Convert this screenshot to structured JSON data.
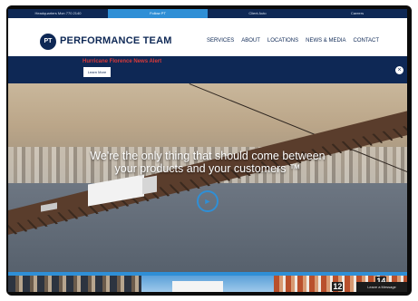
{
  "utility_bar": [
    {
      "label": "Headquarters Mon 770 2140"
    },
    {
      "label": "Follow PT"
    },
    {
      "label": "Client Auto"
    },
    {
      "label": "Careers"
    }
  ],
  "brand": {
    "mark": "PT",
    "name": "PERFORMANCE TEAM"
  },
  "nav": [
    "SERVICES",
    "ABOUT",
    "LOCATIONS",
    "NEWS & MEDIA",
    "CONTACT"
  ],
  "alert": {
    "title": "Hurricane Florence News Alert",
    "button": "Learn More",
    "close": "×"
  },
  "hero": {
    "tagline_line1": "We're the only thing that should come between",
    "tagline_line2": "your products and your customers ™"
  },
  "tiles": {
    "num1": "12",
    "num2": "14"
  },
  "chat": {
    "label": "Leave a Message"
  },
  "colors": {
    "navy": "#0e2855",
    "accent": "#2f8fd6",
    "alert_red": "#d93a3a"
  }
}
